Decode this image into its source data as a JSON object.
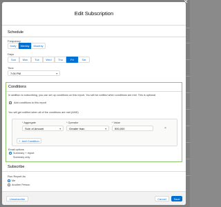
{
  "modal": {
    "title": "Edit Subscription"
  },
  "schedule": {
    "section_title": "Schedule",
    "frequency_label": "Frequency",
    "frequency_options": [
      "Daily",
      "Weekly",
      "Monthly"
    ],
    "frequency_selected": "Weekly",
    "days_label": "Days",
    "days": [
      "Sun",
      "Mon",
      "Tue",
      "Wed",
      "Thu",
      "Fri",
      "Sat"
    ],
    "days_selected": "Fri",
    "time_label": "Time",
    "time_value": "7:00 PM"
  },
  "conditions": {
    "section_title": "Conditions",
    "info_text": "In addition to subscribing, you can set up conditions on this report. You will be notified when conditions are met. This is optional.",
    "add_conditions_label": "Add conditions to this report",
    "add_conditions_checked": true,
    "notify_text": "You will get notified when all of the conditions are met (AND)",
    "aggregate_label": "Aggregate",
    "aggregate_value": "Sum of Amount",
    "operator_label": "Operator",
    "operator_value": "Greater than",
    "value_label": "Value",
    "value_value": "500,000",
    "add_condition_button": "Add Condition",
    "email_options_label": "Email options",
    "email_options": [
      "Summary + report",
      "Summary only"
    ],
    "email_option_selected": "Summary + report"
  },
  "subscribe": {
    "section_title": "Subscribe",
    "run_report_as_label": "Run Report As",
    "run_as_options": [
      "Me",
      "Another Person"
    ],
    "run_as_selected": "Me"
  },
  "footer": {
    "unsubscribe_label": "Unsubscribe",
    "cancel_label": "Cancel",
    "save_label": "Save"
  },
  "colors": {
    "brand": "#0070d2",
    "conditions_highlight": "#8fc46c"
  }
}
